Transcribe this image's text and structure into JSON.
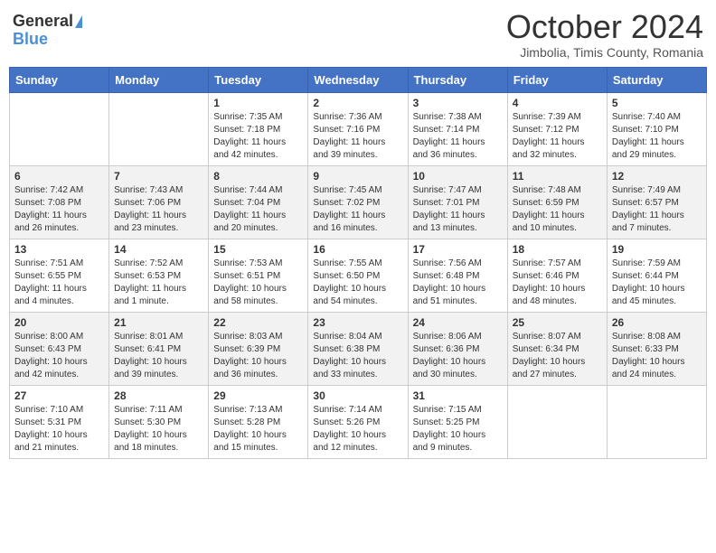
{
  "header": {
    "logo_general": "General",
    "logo_blue": "Blue",
    "month": "October 2024",
    "location": "Jimbolia, Timis County, Romania"
  },
  "weekdays": [
    "Sunday",
    "Monday",
    "Tuesday",
    "Wednesday",
    "Thursday",
    "Friday",
    "Saturday"
  ],
  "weeks": [
    [
      {
        "day": "",
        "sunrise": "",
        "sunset": "",
        "daylight": ""
      },
      {
        "day": "",
        "sunrise": "",
        "sunset": "",
        "daylight": ""
      },
      {
        "day": "1",
        "sunrise": "Sunrise: 7:35 AM",
        "sunset": "Sunset: 7:18 PM",
        "daylight": "Daylight: 11 hours and 42 minutes."
      },
      {
        "day": "2",
        "sunrise": "Sunrise: 7:36 AM",
        "sunset": "Sunset: 7:16 PM",
        "daylight": "Daylight: 11 hours and 39 minutes."
      },
      {
        "day": "3",
        "sunrise": "Sunrise: 7:38 AM",
        "sunset": "Sunset: 7:14 PM",
        "daylight": "Daylight: 11 hours and 36 minutes."
      },
      {
        "day": "4",
        "sunrise": "Sunrise: 7:39 AM",
        "sunset": "Sunset: 7:12 PM",
        "daylight": "Daylight: 11 hours and 32 minutes."
      },
      {
        "day": "5",
        "sunrise": "Sunrise: 7:40 AM",
        "sunset": "Sunset: 7:10 PM",
        "daylight": "Daylight: 11 hours and 29 minutes."
      }
    ],
    [
      {
        "day": "6",
        "sunrise": "Sunrise: 7:42 AM",
        "sunset": "Sunset: 7:08 PM",
        "daylight": "Daylight: 11 hours and 26 minutes."
      },
      {
        "day": "7",
        "sunrise": "Sunrise: 7:43 AM",
        "sunset": "Sunset: 7:06 PM",
        "daylight": "Daylight: 11 hours and 23 minutes."
      },
      {
        "day": "8",
        "sunrise": "Sunrise: 7:44 AM",
        "sunset": "Sunset: 7:04 PM",
        "daylight": "Daylight: 11 hours and 20 minutes."
      },
      {
        "day": "9",
        "sunrise": "Sunrise: 7:45 AM",
        "sunset": "Sunset: 7:02 PM",
        "daylight": "Daylight: 11 hours and 16 minutes."
      },
      {
        "day": "10",
        "sunrise": "Sunrise: 7:47 AM",
        "sunset": "Sunset: 7:01 PM",
        "daylight": "Daylight: 11 hours and 13 minutes."
      },
      {
        "day": "11",
        "sunrise": "Sunrise: 7:48 AM",
        "sunset": "Sunset: 6:59 PM",
        "daylight": "Daylight: 11 hours and 10 minutes."
      },
      {
        "day": "12",
        "sunrise": "Sunrise: 7:49 AM",
        "sunset": "Sunset: 6:57 PM",
        "daylight": "Daylight: 11 hours and 7 minutes."
      }
    ],
    [
      {
        "day": "13",
        "sunrise": "Sunrise: 7:51 AM",
        "sunset": "Sunset: 6:55 PM",
        "daylight": "Daylight: 11 hours and 4 minutes."
      },
      {
        "day": "14",
        "sunrise": "Sunrise: 7:52 AM",
        "sunset": "Sunset: 6:53 PM",
        "daylight": "Daylight: 11 hours and 1 minute."
      },
      {
        "day": "15",
        "sunrise": "Sunrise: 7:53 AM",
        "sunset": "Sunset: 6:51 PM",
        "daylight": "Daylight: 10 hours and 58 minutes."
      },
      {
        "day": "16",
        "sunrise": "Sunrise: 7:55 AM",
        "sunset": "Sunset: 6:50 PM",
        "daylight": "Daylight: 10 hours and 54 minutes."
      },
      {
        "day": "17",
        "sunrise": "Sunrise: 7:56 AM",
        "sunset": "Sunset: 6:48 PM",
        "daylight": "Daylight: 10 hours and 51 minutes."
      },
      {
        "day": "18",
        "sunrise": "Sunrise: 7:57 AM",
        "sunset": "Sunset: 6:46 PM",
        "daylight": "Daylight: 10 hours and 48 minutes."
      },
      {
        "day": "19",
        "sunrise": "Sunrise: 7:59 AM",
        "sunset": "Sunset: 6:44 PM",
        "daylight": "Daylight: 10 hours and 45 minutes."
      }
    ],
    [
      {
        "day": "20",
        "sunrise": "Sunrise: 8:00 AM",
        "sunset": "Sunset: 6:43 PM",
        "daylight": "Daylight: 10 hours and 42 minutes."
      },
      {
        "day": "21",
        "sunrise": "Sunrise: 8:01 AM",
        "sunset": "Sunset: 6:41 PM",
        "daylight": "Daylight: 10 hours and 39 minutes."
      },
      {
        "day": "22",
        "sunrise": "Sunrise: 8:03 AM",
        "sunset": "Sunset: 6:39 PM",
        "daylight": "Daylight: 10 hours and 36 minutes."
      },
      {
        "day": "23",
        "sunrise": "Sunrise: 8:04 AM",
        "sunset": "Sunset: 6:38 PM",
        "daylight": "Daylight: 10 hours and 33 minutes."
      },
      {
        "day": "24",
        "sunrise": "Sunrise: 8:06 AM",
        "sunset": "Sunset: 6:36 PM",
        "daylight": "Daylight: 10 hours and 30 minutes."
      },
      {
        "day": "25",
        "sunrise": "Sunrise: 8:07 AM",
        "sunset": "Sunset: 6:34 PM",
        "daylight": "Daylight: 10 hours and 27 minutes."
      },
      {
        "day": "26",
        "sunrise": "Sunrise: 8:08 AM",
        "sunset": "Sunset: 6:33 PM",
        "daylight": "Daylight: 10 hours and 24 minutes."
      }
    ],
    [
      {
        "day": "27",
        "sunrise": "Sunrise: 7:10 AM",
        "sunset": "Sunset: 5:31 PM",
        "daylight": "Daylight: 10 hours and 21 minutes."
      },
      {
        "day": "28",
        "sunrise": "Sunrise: 7:11 AM",
        "sunset": "Sunset: 5:30 PM",
        "daylight": "Daylight: 10 hours and 18 minutes."
      },
      {
        "day": "29",
        "sunrise": "Sunrise: 7:13 AM",
        "sunset": "Sunset: 5:28 PM",
        "daylight": "Daylight: 10 hours and 15 minutes."
      },
      {
        "day": "30",
        "sunrise": "Sunrise: 7:14 AM",
        "sunset": "Sunset: 5:26 PM",
        "daylight": "Daylight: 10 hours and 12 minutes."
      },
      {
        "day": "31",
        "sunrise": "Sunrise: 7:15 AM",
        "sunset": "Sunset: 5:25 PM",
        "daylight": "Daylight: 10 hours and 9 minutes."
      },
      {
        "day": "",
        "sunrise": "",
        "sunset": "",
        "daylight": ""
      },
      {
        "day": "",
        "sunrise": "",
        "sunset": "",
        "daylight": ""
      }
    ]
  ]
}
